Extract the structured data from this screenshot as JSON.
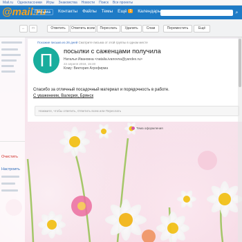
{
  "topbar": {
    "links": [
      "Mail.ru",
      "Одноклассники",
      "Игры",
      "Знакомства",
      "Новости",
      "Поиск",
      "Все проекты"
    ]
  },
  "header": {
    "logo": "@mail.ru",
    "nav": [
      "Письма",
      "Контакты",
      "Файлы",
      "Темы",
      "Ещё",
      "Календарь"
    ],
    "badge": "1"
  },
  "toolbar": {
    "buttons": [
      "Ответить",
      "Ответить всем",
      "Переслать",
      "Удалить",
      "Спам",
      "Переместить",
      "Ещё"
    ]
  },
  "sidebar": {
    "items": [
      "Написать",
      "Входящие",
      "Отправленные",
      "Черновики",
      "Спам",
      "Корзина"
    ],
    "red_item": "Очистить",
    "blue_item": "Настроить"
  },
  "message": {
    "spam_notice": "Похожие письма из 26 дней",
    "spam_notice_rest": "Смотрите письма от этой группы в одном месте",
    "avatar_letter": "П",
    "subject": "посылки с саженцами получила",
    "from": "Наталья Ивановна <natalia.ivanovna@yandex.ru>",
    "date": "22 апреля 2018, 15:40",
    "to": "Кому: Виктория Агрофирма",
    "body": "Спасибо за отличный посадочный материал и порядочность в работе.",
    "signature": "С уважением, Валерия, Брянск",
    "reply_placeholder": "Нажмите, чтобы ответить, Ответить всем или Переслать"
  },
  "branding": "Тема оформления"
}
